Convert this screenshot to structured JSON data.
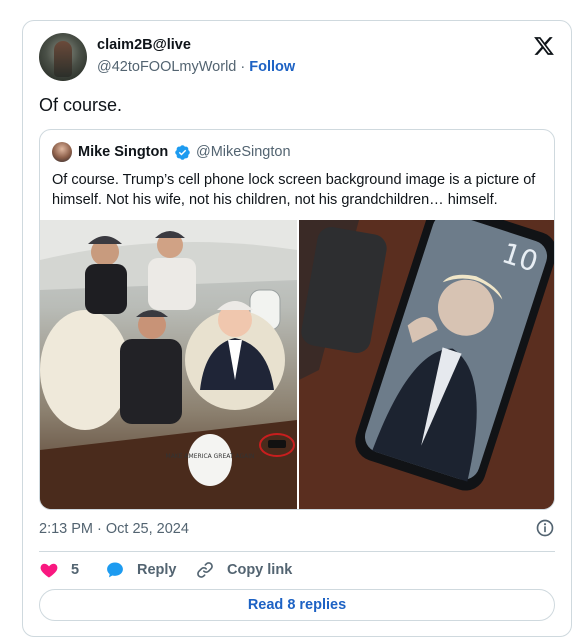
{
  "author": {
    "name": "claim2B@live",
    "handle": "@42toFOOLmyWorld",
    "separator": " · ",
    "follow_label": "Follow"
  },
  "tweet": {
    "text": "Of course.",
    "timestamp": "2:13 PM · Oct 25, 2024"
  },
  "quoted": {
    "name": "Mike Sington",
    "handle": "@MikeSington",
    "text": "Of course. Trump’s cell phone lock screen background image is a picture of himself. Not his wife, not his children, not his grandchildren… himself.",
    "photo_left_hat_text": "MAKE AMERICA GREAT AGAIN",
    "photo_right_clock": "10"
  },
  "actions": {
    "like_count": "5",
    "reply_label": "Reply",
    "copy_label": "Copy link",
    "read_replies_label": "Read 8 replies"
  },
  "colors": {
    "link": "#1d62c4",
    "like": "#f91880",
    "reply": "#1d9bf0",
    "secondary_text": "#536471",
    "border": "#cfd9de"
  },
  "icons": [
    "x-logo-icon",
    "verified-badge-icon",
    "info-icon",
    "heart-icon",
    "reply-bubble-icon",
    "link-icon"
  ]
}
